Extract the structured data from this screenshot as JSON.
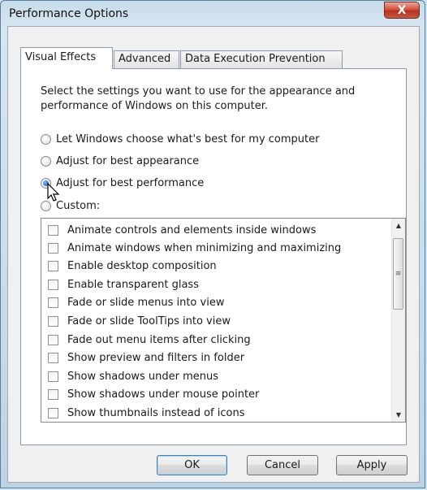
{
  "window": {
    "title": "Performance Options",
    "close_glyph": "X"
  },
  "tabs": [
    {
      "label": "Visual Effects",
      "active": true
    },
    {
      "label": "Advanced",
      "active": false
    },
    {
      "label": "Data Execution Prevention",
      "active": false
    }
  ],
  "visual_effects": {
    "description": "Select the settings you want to use for the appearance and performance of Windows on this computer.",
    "options": [
      {
        "label": "Let Windows choose what's best for my computer",
        "checked": false
      },
      {
        "label": "Adjust for best appearance",
        "checked": false
      },
      {
        "label": "Adjust for best performance",
        "checked": true
      },
      {
        "label": "Custom:",
        "checked": false
      }
    ],
    "effects": [
      {
        "label": "Animate controls and elements inside windows",
        "checked": false
      },
      {
        "label": "Animate windows when minimizing and maximizing",
        "checked": false
      },
      {
        "label": "Enable desktop composition",
        "checked": false
      },
      {
        "label": "Enable transparent glass",
        "checked": false
      },
      {
        "label": "Fade or slide menus into view",
        "checked": false
      },
      {
        "label": "Fade or slide ToolTips into view",
        "checked": false
      },
      {
        "label": "Fade out menu items after clicking",
        "checked": false
      },
      {
        "label": "Show preview and filters in folder",
        "checked": false
      },
      {
        "label": "Show shadows under menus",
        "checked": false
      },
      {
        "label": "Show shadows under mouse pointer",
        "checked": false
      },
      {
        "label": "Show thumbnails instead of icons",
        "checked": false
      }
    ]
  },
  "buttons": {
    "ok": "OK",
    "cancel": "Cancel",
    "apply": "Apply"
  },
  "icons": {
    "close": "close-icon",
    "scroll_up": "scroll-up-arrow-icon",
    "scroll_down": "scroll-down-arrow-icon",
    "cursor": "mouse-pointer-icon"
  },
  "colors": {
    "title_close": "#c9563f",
    "selection_radio": "#1559b5",
    "default_button_border": "#3c7fb1"
  }
}
